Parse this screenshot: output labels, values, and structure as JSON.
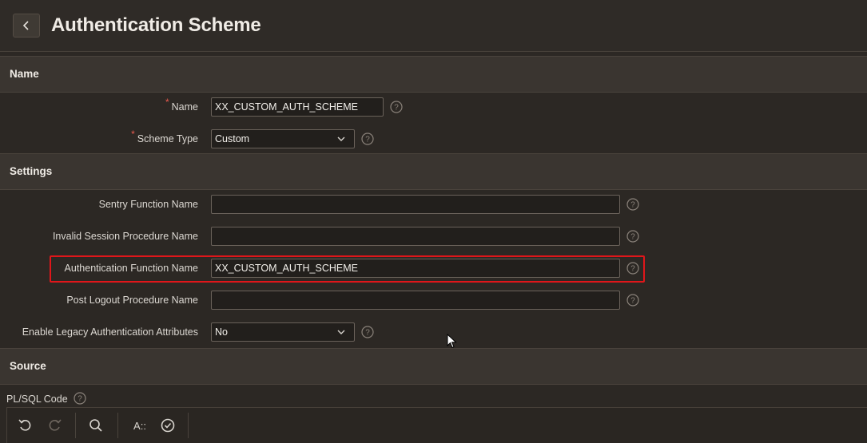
{
  "header": {
    "title": "Authentication Scheme"
  },
  "sections": {
    "name": "Name",
    "settings": "Settings",
    "source": "Source"
  },
  "fields": {
    "name": {
      "label": "Name",
      "required": true,
      "value": "XX_CUSTOM_AUTH_SCHEME"
    },
    "scheme_type": {
      "label": "Scheme Type",
      "required": true,
      "value": "Custom"
    },
    "sentry_function": {
      "label": "Sentry Function Name",
      "value": ""
    },
    "invalid_session": {
      "label": "Invalid Session Procedure Name",
      "value": ""
    },
    "auth_function": {
      "label": "Authentication Function Name",
      "value": "XX_CUSTOM_AUTH_SCHEME"
    },
    "post_logout": {
      "label": "Post Logout Procedure Name",
      "value": ""
    },
    "legacy_attrs": {
      "label": "Enable Legacy Authentication Attributes",
      "value": "No"
    }
  },
  "code": {
    "label": "PL/SQL Code"
  },
  "toolbar": {
    "undo": "undo-icon",
    "redo": "redo-icon",
    "search": "search-icon",
    "autocomplete": "A::",
    "validate": "check-circle-icon"
  },
  "colors": {
    "background": "#2c2824",
    "section": "#3a3530",
    "required": "#e85a4f",
    "highlight": "#e0161a"
  }
}
